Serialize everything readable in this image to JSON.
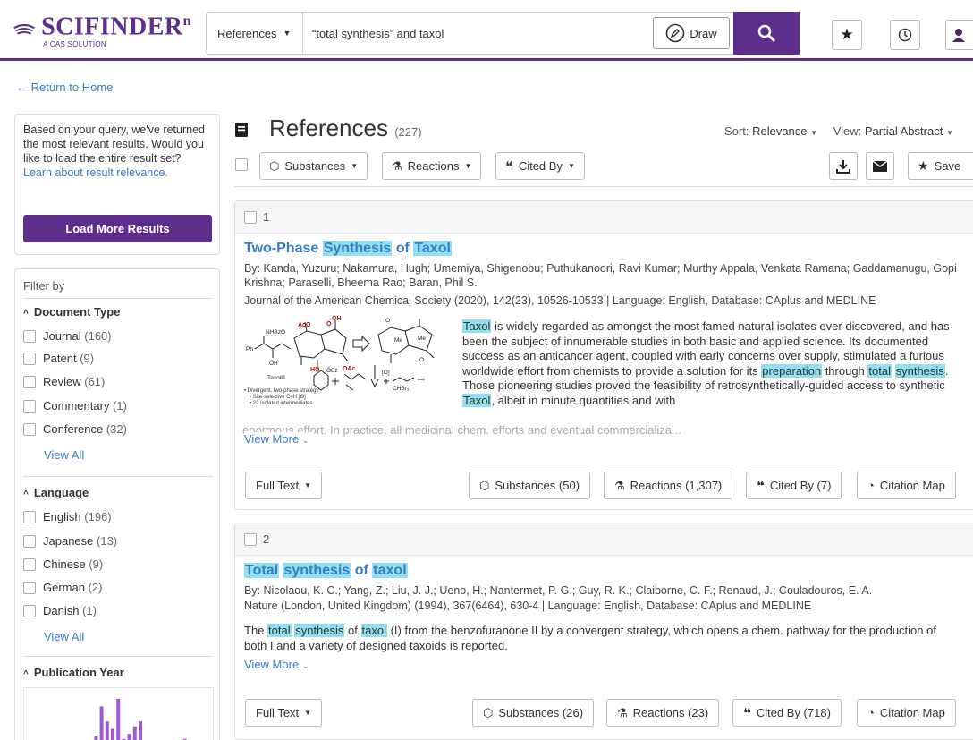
{
  "app": {
    "logo_name": "SCIFINDER",
    "logo_sup": "n",
    "logo_sub": "A CAS SOLUTION"
  },
  "search": {
    "type": "References",
    "query": "“total synthesis” and taxol",
    "clear": "×",
    "draw_label": "Draw"
  },
  "nav": {
    "return_link": "Return to Home"
  },
  "info": {
    "text": "Based on your query, we've returned the most relevant results. Would you like to load the entire result set?",
    "link": "Learn about result relevance.",
    "load_button": "Load More Results"
  },
  "filters": {
    "title": "Filter by",
    "view_all": "View All",
    "sections": [
      {
        "title": "Document Type",
        "items": [
          {
            "label": "Journal",
            "count": "(160)"
          },
          {
            "label": "Patent",
            "count": "(9)"
          },
          {
            "label": "Review",
            "count": "(61)"
          },
          {
            "label": "Commentary",
            "count": "(1)"
          },
          {
            "label": "Conference",
            "count": "(32)"
          }
        ]
      },
      {
        "title": "Language",
        "items": [
          {
            "label": "English",
            "count": "(196)"
          },
          {
            "label": "Japanese",
            "count": "(13)"
          },
          {
            "label": "Chinese",
            "count": "(9)"
          },
          {
            "label": "German",
            "count": "(2)"
          },
          {
            "label": "Danish",
            "count": "(1)"
          }
        ]
      },
      {
        "title": "Publication Year",
        "histogram": [
          0.05,
          0.1,
          0.25,
          0.85,
          0.55,
          0.4,
          1.0,
          0.2,
          0.3,
          0.45,
          0.55,
          0.15,
          0.05,
          0.1,
          0.12,
          0.12,
          0.18,
          0.1,
          0.2,
          0.08,
          0.1
        ]
      }
    ]
  },
  "results": {
    "title": "References",
    "count": "(227)",
    "sort_label": "Sort:",
    "sort_value": "Relevance",
    "view_label": "View:",
    "view_value": "Partial Abstract",
    "toolbar": {
      "substances": "Substances",
      "reactions": "Reactions",
      "cited_by": "Cited By",
      "save": "Save"
    },
    "items": [
      {
        "index": "1",
        "title_parts": [
          {
            "t": "Two-Phase ",
            "hl": false
          },
          {
            "t": "Synthesis",
            "hl": true
          },
          {
            "t": " of ",
            "hl": false
          },
          {
            "t": "Taxol",
            "hl": true
          }
        ],
        "authors": "By: Kanda, Yuzuru; Nakamura, Hugh; Umemiya, Shigenobu; Puthukanoori, Ravi Kumar; Murthy Appala, Venkata Ramana; Gaddamanugu, Gopi Krishna; Paraselli, Bheema Rao; Baran, Phil S.",
        "source": "Journal of the American Chemical Society (2020), 142(23), 10526-10533 | Language: English, Database: CAplus and MEDLINE",
        "abstract_parts": [
          {
            "t": "Taxol",
            "hl": true
          },
          {
            "t": " is widely regarded as amongst the most famed natural isolates ever discovered, and has been the subject of innumerable studies in both basic and applied science. Its documented success as an anticancer agent, coupled with early concerns over supply, stimulated a furious worldwide effort from chemists to provide a solution for its ",
            "hl": false
          },
          {
            "t": "preparation",
            "hl": true
          },
          {
            "t": " through ",
            "hl": false
          },
          {
            "t": "total",
            "hl": true
          },
          {
            "t": " ",
            "hl": false
          },
          {
            "t": "synthesis",
            "hl": true
          },
          {
            "t": ". Those pioneering studies proved the feasibility of retrosynthetically-guided access to synthetic ",
            "hl": false
          },
          {
            "t": "Taxol",
            "hl": true
          },
          {
            "t": ", albeit in minute quantities and with",
            "hl": false
          }
        ],
        "abstract_overflow": "enormous effort. In practice, all medicinal chem. efforts and eventual commercializa...",
        "graphic_notes": [
          "• Divergent, two-phase strategy",
          "• Site-selective C–H [O]",
          "• 22 isolated intermediates"
        ],
        "graphic_label": "Taxol®",
        "view_more": "View More",
        "full_text": "Full Text",
        "substances": "Substances (50)",
        "reactions": "Reactions (1,307)",
        "cited_by": "Cited By (7)",
        "citation_map": "Citation Map"
      },
      {
        "index": "2",
        "title_parts": [
          {
            "t": "Total",
            "hl": true
          },
          {
            "t": " ",
            "hl": false
          },
          {
            "t": "synthesis",
            "hl": true
          },
          {
            "t": " of ",
            "hl": false
          },
          {
            "t": "taxol",
            "hl": true
          }
        ],
        "authors": "By: Nicolaou, K. C.; Yang, Z.; Liu, J. J.; Ueno, H.; Nantermet, P. G.; Guy, R. K.; Claiborne, C. F.; Renaud, J.; Couladouros, E. A.",
        "source": "Nature (London, United Kingdom) (1994), 367(6464), 630-4 | Language: English, Database: CAplus and MEDLINE",
        "abstract_parts": [
          {
            "t": "The ",
            "hl": false
          },
          {
            "t": "total",
            "hl": true
          },
          {
            "t": " ",
            "hl": false
          },
          {
            "t": "synthesis",
            "hl": true
          },
          {
            "t": " of ",
            "hl": false
          },
          {
            "t": "taxol",
            "hl": true
          },
          {
            "t": " (I) from the benzofuranone II by a convergent strategy, which opens a chem. pathway for the production of both I and a variety of designed taxoids is reported.",
            "hl": false
          }
        ],
        "view_more": "View More",
        "full_text": "Full Text",
        "substances": "Substances (26)",
        "reactions": "Reactions (23)",
        "cited_by": "Cited By (718)",
        "citation_map": "Citation Map"
      }
    ]
  },
  "colors": {
    "brand": "#5d2e8c",
    "link": "#3a7bc8",
    "highlight": "#8fe0f0",
    "chart_bar": "#a05ad0"
  }
}
